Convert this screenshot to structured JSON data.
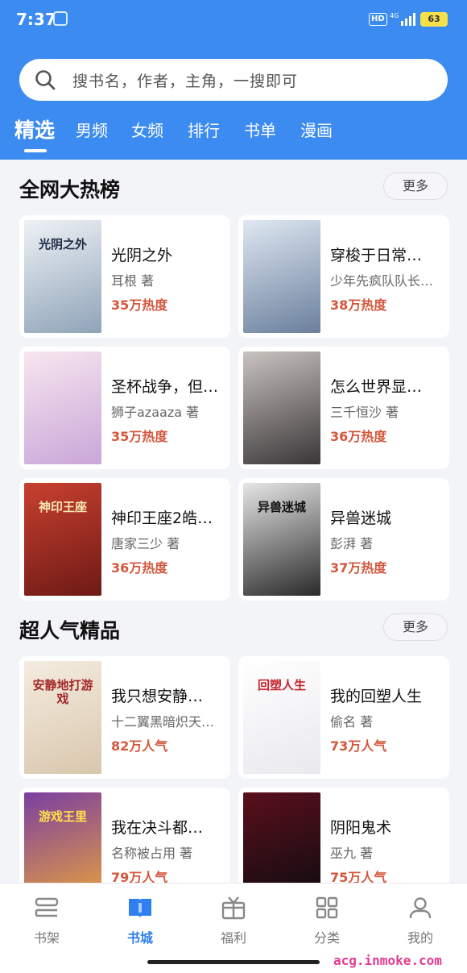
{
  "status": {
    "time": "7:37",
    "hd": "HD",
    "network": "4G",
    "battery": "63"
  },
  "search": {
    "placeholder": "搜书名，作者，主角，一搜即可"
  },
  "tabs": [
    {
      "label": "精选",
      "active": true
    },
    {
      "label": "男频"
    },
    {
      "label": "女频"
    },
    {
      "label": "排行"
    },
    {
      "label": "书单"
    },
    {
      "label": "漫画"
    }
  ],
  "sections": [
    {
      "title": "全网大热榜",
      "more_label": "更多",
      "books": [
        {
          "title": "光阴之外",
          "author": "耳根 著",
          "heat": "35万热度",
          "cover_text": "光阴之外",
          "cover_colors": [
            "#eef2f6",
            "#8fa3b8"
          ],
          "cover_text_color": "#1c2a45"
        },
        {
          "title": "穿梭于日常…",
          "author": "少年先疯队队长…",
          "heat": "38万热度",
          "cover_text": "",
          "cover_colors": [
            "#dfe8f2",
            "#6a7f9c"
          ],
          "cover_text_color": "#fff"
        },
        {
          "title": "圣杯战争，但…",
          "author": "狮子azaaza 著",
          "heat": "35万热度",
          "cover_text": "",
          "cover_colors": [
            "#f7e6ef",
            "#c9a6d8"
          ],
          "cover_text_color": "#fff"
        },
        {
          "title": "怎么世界显…",
          "author": "三千恒沙 著",
          "heat": "36万热度",
          "cover_text": "",
          "cover_colors": [
            "#c9c4c0",
            "#3a3537"
          ],
          "cover_text_color": "#fff"
        },
        {
          "title": "神印王座2皓…",
          "author": "唐家三少 著",
          "heat": "36万热度",
          "cover_text": "神印王座",
          "cover_colors": [
            "#c8402f",
            "#6e1a16"
          ],
          "cover_text_color": "#f8e7b0"
        },
        {
          "title": "异兽迷城",
          "author": "彭湃 著",
          "heat": "37万热度",
          "cover_text": "异兽迷城",
          "cover_colors": [
            "#e6e6e6",
            "#2a2a2a"
          ],
          "cover_text_color": "#111"
        }
      ]
    },
    {
      "title": "超人气精品",
      "more_label": "更多",
      "books": [
        {
          "title": "我只想安静…",
          "author": "十二翼黑暗炽天…",
          "heat": "82万人气",
          "cover_text": "安静地打游戏",
          "cover_colors": [
            "#f4ece0",
            "#d9c7ad"
          ],
          "cover_text_color": "#a4282a"
        },
        {
          "title": "我的回塑人生",
          "author": "偷名 著",
          "heat": "73万人气",
          "cover_text": "回塑人生",
          "cover_colors": [
            "#ffffff",
            "#e9e9ee"
          ],
          "cover_text_color": "#c8232c"
        },
        {
          "title": "我在决斗都…",
          "author": "名称被占用 著",
          "heat": "79万人气",
          "cover_text": "游戏王里",
          "cover_colors": [
            "#7b3fa1",
            "#e9a23b"
          ],
          "cover_text_color": "#ffe24a"
        },
        {
          "title": "阴阳鬼术",
          "author": "巫九 著",
          "heat": "75万人气",
          "cover_text": "",
          "cover_colors": [
            "#5a0f1c",
            "#0c0c10"
          ],
          "cover_text_color": "#fff"
        }
      ]
    }
  ],
  "tabbar": [
    {
      "label": "书架",
      "icon": "bookshelf-icon"
    },
    {
      "label": "书城",
      "icon": "book-open-icon",
      "active": true
    },
    {
      "label": "福利",
      "icon": "gift-icon"
    },
    {
      "label": "分类",
      "icon": "grid-icon"
    },
    {
      "label": "我的",
      "icon": "person-icon"
    }
  ],
  "watermark": "acg.inmoke.com"
}
